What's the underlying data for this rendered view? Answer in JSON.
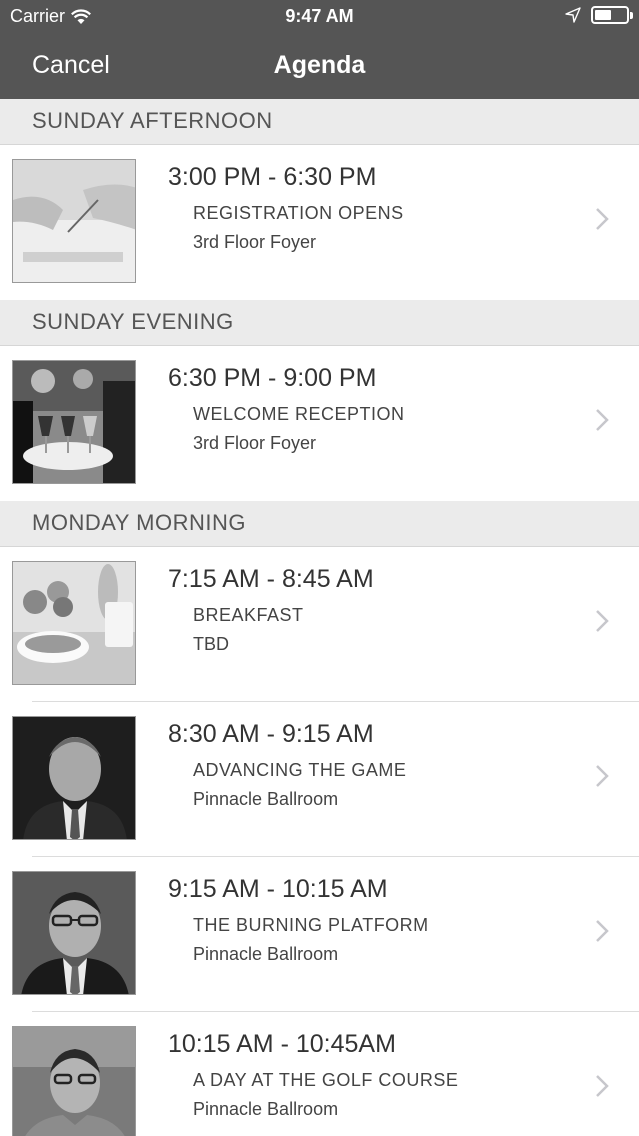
{
  "status_bar": {
    "carrier": "Carrier",
    "time": "9:47 AM"
  },
  "nav": {
    "cancel_label": "Cancel",
    "title": "Agenda"
  },
  "sections": [
    {
      "title": "SUNDAY AFTERNOON",
      "items": [
        {
          "time": "3:00 PM - 6:30 PM",
          "session": "REGISTRATION OPENS",
          "location": "3rd Floor Foyer",
          "image": "registration-photo"
        }
      ]
    },
    {
      "title": "SUNDAY EVENING",
      "items": [
        {
          "time": "6:30 PM - 9:00 PM",
          "session": "WELCOME RECEPTION",
          "location": "3rd Floor Foyer",
          "image": "reception-photo"
        }
      ]
    },
    {
      "title": "MONDAY MORNING",
      "items": [
        {
          "time": "7:15 AM - 8:45 AM",
          "session": "BREAKFAST",
          "location": "TBD",
          "image": "breakfast-photo"
        },
        {
          "time": "8:30 AM - 9:15 AM",
          "session": "ADVANCING THE GAME",
          "location": "Pinnacle Ballroom",
          "image": "speaker-photo"
        },
        {
          "time": "9:15 AM - 10:15 AM",
          "session": "THE BURNING PLATFORM",
          "location": "Pinnacle Ballroom",
          "image": "speaker-photo"
        },
        {
          "time": "10:15 AM - 10:45AM",
          "session": "A DAY AT THE GOLF COURSE",
          "location": "Pinnacle Ballroom",
          "image": "speaker-photo"
        }
      ]
    }
  ],
  "colors": {
    "nav_background": "#555555",
    "section_background": "#ebebeb",
    "chevron": "#c7c7cc"
  }
}
